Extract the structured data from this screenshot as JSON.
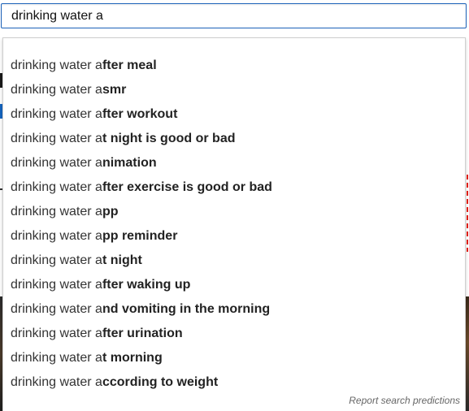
{
  "search": {
    "value": "drinking water a"
  },
  "suggestions": [
    {
      "typed": "drinking water a",
      "completion": "fter meal"
    },
    {
      "typed": "drinking water a",
      "completion": "smr"
    },
    {
      "typed": "drinking water a",
      "completion": "fter workout"
    },
    {
      "typed": "drinking water a",
      "completion": "t night is good or bad"
    },
    {
      "typed": "drinking water a",
      "completion": "nimation"
    },
    {
      "typed": "drinking water a",
      "completion": "fter exercise is good or bad"
    },
    {
      "typed": "drinking water a",
      "completion": "pp"
    },
    {
      "typed": "drinking water a",
      "completion": "pp reminder"
    },
    {
      "typed": "drinking water a",
      "completion": "t night"
    },
    {
      "typed": "drinking water a",
      "completion": "fter waking up"
    },
    {
      "typed": "drinking water a",
      "completion": "nd vomiting in the morning"
    },
    {
      "typed": "drinking water a",
      "completion": "fter urination"
    },
    {
      "typed": "drinking water a",
      "completion": "t morning"
    },
    {
      "typed": "drinking water a",
      "completion": "ccording to weight"
    }
  ],
  "report_link": "Report search predictions",
  "colors": {
    "input_border": "#1c62b9",
    "text": "#222222",
    "muted": "#666666"
  }
}
